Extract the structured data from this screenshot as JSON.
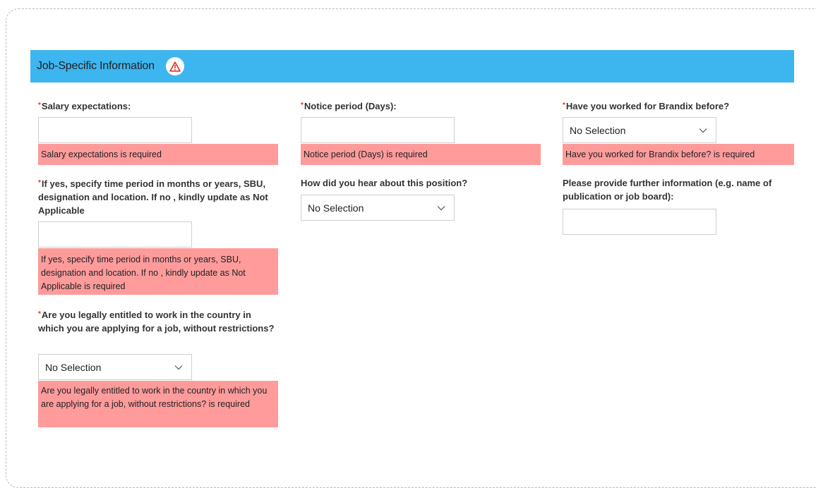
{
  "section": {
    "title": "Job-Specific Information",
    "warning_icon": "warning-triangle-icon",
    "header_color": "#3db5ef",
    "error_color": "#ff9b9b"
  },
  "fields": {
    "salary": {
      "required_mark": "*",
      "label": "Salary expectations:",
      "value": "",
      "error": "Salary expectations is required"
    },
    "notice": {
      "required_mark": "*",
      "label": "Notice period (Days):",
      "value": "",
      "error": "Notice period (Days) is required"
    },
    "worked_before": {
      "required_mark": "*",
      "label": "Have you worked for Brandix before?",
      "selected": "No Selection",
      "error": "Have you worked for Brandix before? is required"
    },
    "time_period": {
      "required_mark": "*",
      "label": "If yes, specify time period in months or years, SBU, designation and location. If no , kindly update as Not Applicable",
      "value": "",
      "error": "If yes, specify time period in months or years, SBU, designation and location. If no , kindly update as Not Applicable is required"
    },
    "heard_about": {
      "label": "How did you hear about this position?",
      "selected": "No Selection"
    },
    "further_info": {
      "label": "Please provide further information (e.g. name of publication or job board):",
      "value": ""
    },
    "legally_entitled": {
      "required_mark": "*",
      "label": "Are you legally entitled to work in the country in which you are applying for a job, without restrictions?",
      "selected": "No Selection",
      "error": "Are you legally entitled to work in the country in which you are applying for a job, without restrictions? is required"
    }
  }
}
